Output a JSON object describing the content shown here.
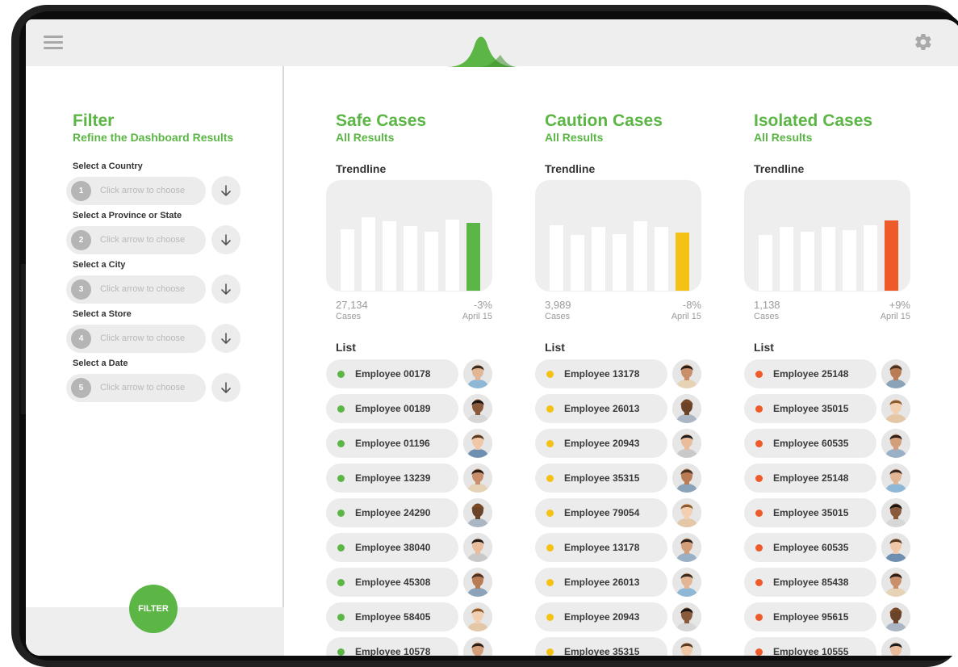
{
  "filter": {
    "title": "Filter",
    "subtitle": "Refine the Dashboard Results",
    "button_label": "FILTER",
    "selectors": [
      {
        "num": "1",
        "label": "Select a Country",
        "placeholder": "Click arrow to choose"
      },
      {
        "num": "2",
        "label": "Select a Province or State",
        "placeholder": "Click arrow to choose"
      },
      {
        "num": "3",
        "label": "Select a City",
        "placeholder": "Click arrow to choose"
      },
      {
        "num": "4",
        "label": "Select a Store",
        "placeholder": "Click arrow to choose"
      },
      {
        "num": "5",
        "label": "Select a Date",
        "placeholder": "Click arrow to choose"
      }
    ]
  },
  "colors": {
    "brand_green": "#5bb645",
    "caution_yellow": "#f5c115",
    "isolated_red": "#ef5a2b",
    "panel_grey": "#eeeeee"
  },
  "icons": {
    "menu": "hamburger-icon",
    "settings": "gear-icon",
    "logo": "curve-logo-icon",
    "dropdown": "arrow-down-icon"
  },
  "columns": [
    {
      "title": "Safe Cases",
      "subtitle": "All Results",
      "trend_label": "Trendline",
      "count": "27,134",
      "count_unit": "Cases",
      "change": "-3%",
      "date": "April 15",
      "list_label": "List",
      "accent": "#5bb645",
      "trend_values": [
        0.55,
        0.66,
        0.62,
        0.58,
        0.53,
        0.64,
        0.61
      ],
      "employees": [
        "Employee 00178",
        "Employee 00189",
        "Employee 01196",
        "Employee 13239",
        "Employee 24290",
        "Employee 38040",
        "Employee 45308",
        "Employee 58405",
        "Employee 10578"
      ]
    },
    {
      "title": "Caution Cases",
      "subtitle": "All Results",
      "trend_label": "Trendline",
      "count": "3,989",
      "count_unit": "Cases",
      "change": "-8%",
      "date": "April 15",
      "list_label": "List",
      "accent": "#f5c115",
      "trend_values": [
        0.59,
        0.5,
        0.57,
        0.51,
        0.62,
        0.57,
        0.52
      ],
      "employees": [
        "Employee 13178",
        "Employee 26013",
        "Employee 20943",
        "Employee 35315",
        "Employee 79054",
        "Employee 13178",
        "Employee 26013",
        "Employee 20943",
        "Employee 35315"
      ]
    },
    {
      "title": "Isolated Cases",
      "subtitle": "All Results",
      "trend_label": "Trendline",
      "count": "1,138",
      "count_unit": "Cases",
      "change": "+9%",
      "date": "April 15",
      "list_label": "List",
      "accent": "#ef5a2b",
      "trend_values": [
        0.5,
        0.57,
        0.53,
        0.57,
        0.54,
        0.59,
        0.63
      ],
      "employees": [
        "Employee 25148",
        "Employee 35015",
        "Employee 60535",
        "Employee 25148",
        "Employee 35015",
        "Employee 60535",
        "Employee 85438",
        "Employee 95615",
        "Employee 10555"
      ]
    }
  ]
}
